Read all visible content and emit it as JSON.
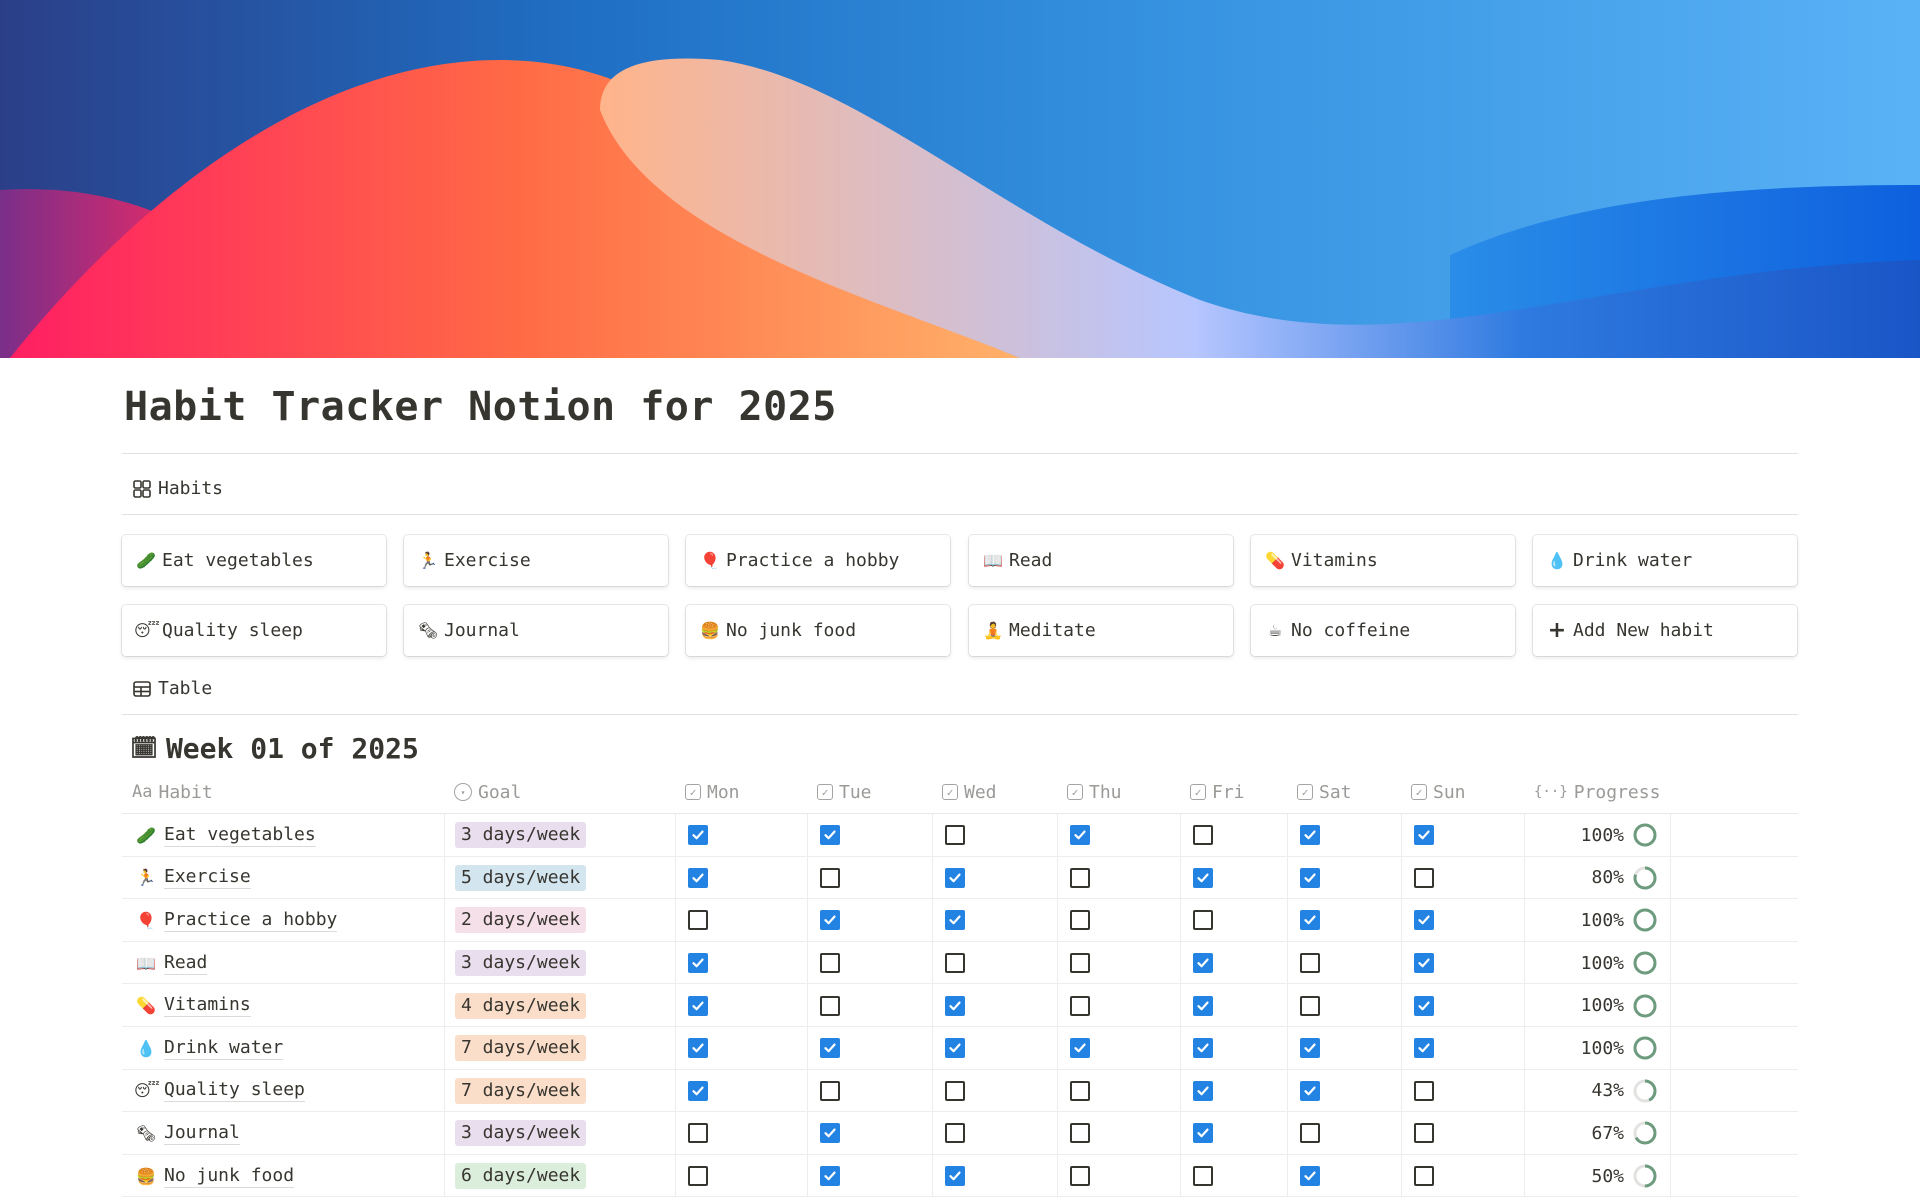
{
  "page": {
    "title": "Habit Tracker Notion for 2025"
  },
  "views": {
    "habits_tab": {
      "label": "Habits",
      "icon": "gallery-icon"
    },
    "table_tab": {
      "label": "Table",
      "icon": "table-icon"
    }
  },
  "habit_cards": [
    {
      "emoji": "🥒",
      "icon": "cucumber-icon",
      "label": "Eat vegetables"
    },
    {
      "emoji": "🏃",
      "icon": "runner-icon",
      "label": "Exercise"
    },
    {
      "emoji": "🎈",
      "icon": "balloon-icon",
      "label": "Practice a hobby"
    },
    {
      "emoji": "📖",
      "icon": "book-icon",
      "label": "Read"
    },
    {
      "emoji": "💊",
      "icon": "pill-icon",
      "label": "Vitamins"
    },
    {
      "emoji": "💧",
      "icon": "droplet-icon",
      "label": "Drink water"
    },
    {
      "emoji": "😴",
      "icon": "sleeping-face-icon",
      "label": "Quality sleep"
    },
    {
      "emoji": "🗞",
      "icon": "newspaper-icon",
      "label": "Journal"
    },
    {
      "emoji": "🍔",
      "icon": "burger-icon",
      "label": "No junk food"
    },
    {
      "emoji": "🧘",
      "icon": "meditation-icon",
      "label": "Meditate"
    },
    {
      "emoji": "☕",
      "icon": "coffee-icon",
      "label": "No coffeine"
    },
    {
      "emoji": "+",
      "icon": "plus-icon",
      "label": "Add New habit"
    }
  ],
  "week": {
    "emoji": "🗓",
    "title": "Week 01 of 2025"
  },
  "table": {
    "columns": [
      {
        "key": "habit",
        "label": "Habit",
        "icon": "Aa"
      },
      {
        "key": "goal",
        "label": "Goal",
        "icon": "▾"
      },
      {
        "key": "mon",
        "label": "Mon",
        "icon": "✓"
      },
      {
        "key": "tue",
        "label": "Tue",
        "icon": "✓"
      },
      {
        "key": "wed",
        "label": "Wed",
        "icon": "✓"
      },
      {
        "key": "thu",
        "label": "Thu",
        "icon": "✓"
      },
      {
        "key": "fri",
        "label": "Fri",
        "icon": "✓"
      },
      {
        "key": "sat",
        "label": "Sat",
        "icon": "✓"
      },
      {
        "key": "sun",
        "label": "Sun",
        "icon": "✓"
      },
      {
        "key": "progress",
        "label": "Progress",
        "icon": "{··}"
      }
    ],
    "goal_colors": {
      "purple": "#e8deee",
      "blue": "#d3e5ef",
      "pink": "#f5e0e9",
      "orange": "#fadec9",
      "green": "#dbeddb"
    },
    "rows": [
      {
        "emoji": "🥒",
        "habit": "Eat vegetables",
        "goal": "3 days/week",
        "goal_color": "purple",
        "days": [
          true,
          true,
          false,
          true,
          false,
          true,
          true
        ],
        "progress": "100%",
        "progress_value": 1.0
      },
      {
        "emoji": "🏃",
        "habit": "Exercise",
        "goal": "5 days/week",
        "goal_color": "blue",
        "days": [
          true,
          false,
          true,
          false,
          true,
          true,
          false
        ],
        "progress": "80%",
        "progress_value": 0.8
      },
      {
        "emoji": "🎈",
        "habit": "Practice a hobby",
        "goal": "2 days/week",
        "goal_color": "pink",
        "days": [
          false,
          true,
          true,
          false,
          false,
          true,
          true
        ],
        "progress": "100%",
        "progress_value": 1.0
      },
      {
        "emoji": "📖",
        "habit": "Read",
        "goal": "3 days/week",
        "goal_color": "purple",
        "days": [
          true,
          false,
          false,
          false,
          true,
          false,
          true
        ],
        "progress": "100%",
        "progress_value": 1.0
      },
      {
        "emoji": "💊",
        "habit": "Vitamins",
        "goal": "4 days/week",
        "goal_color": "orange",
        "days": [
          true,
          false,
          true,
          false,
          true,
          false,
          true
        ],
        "progress": "100%",
        "progress_value": 1.0
      },
      {
        "emoji": "💧",
        "habit": "Drink water",
        "goal": "7 days/week",
        "goal_color": "orange",
        "days": [
          true,
          true,
          true,
          true,
          true,
          true,
          true
        ],
        "progress": "100%",
        "progress_value": 1.0
      },
      {
        "emoji": "😴",
        "habit": "Quality sleep",
        "goal": "7 days/week",
        "goal_color": "orange",
        "days": [
          true,
          false,
          false,
          false,
          true,
          true,
          false
        ],
        "progress": "43%",
        "progress_value": 0.43
      },
      {
        "emoji": "🗞",
        "habit": "Journal",
        "goal": "3 days/week",
        "goal_color": "purple",
        "days": [
          false,
          true,
          false,
          false,
          true,
          false,
          false
        ],
        "progress": "67%",
        "progress_value": 0.67
      },
      {
        "emoji": "🍔",
        "habit": "No junk food",
        "goal": "6 days/week",
        "goal_color": "green",
        "days": [
          false,
          true,
          true,
          false,
          false,
          true,
          false
        ],
        "progress": "50%",
        "progress_value": 0.5
      }
    ]
  },
  "colors": {
    "checkbox_on": "#2383e2",
    "progress_ring": "#6c9b7d",
    "progress_track": "#e3e2e0",
    "text": "#37352f",
    "muted": "#9b9a97"
  }
}
